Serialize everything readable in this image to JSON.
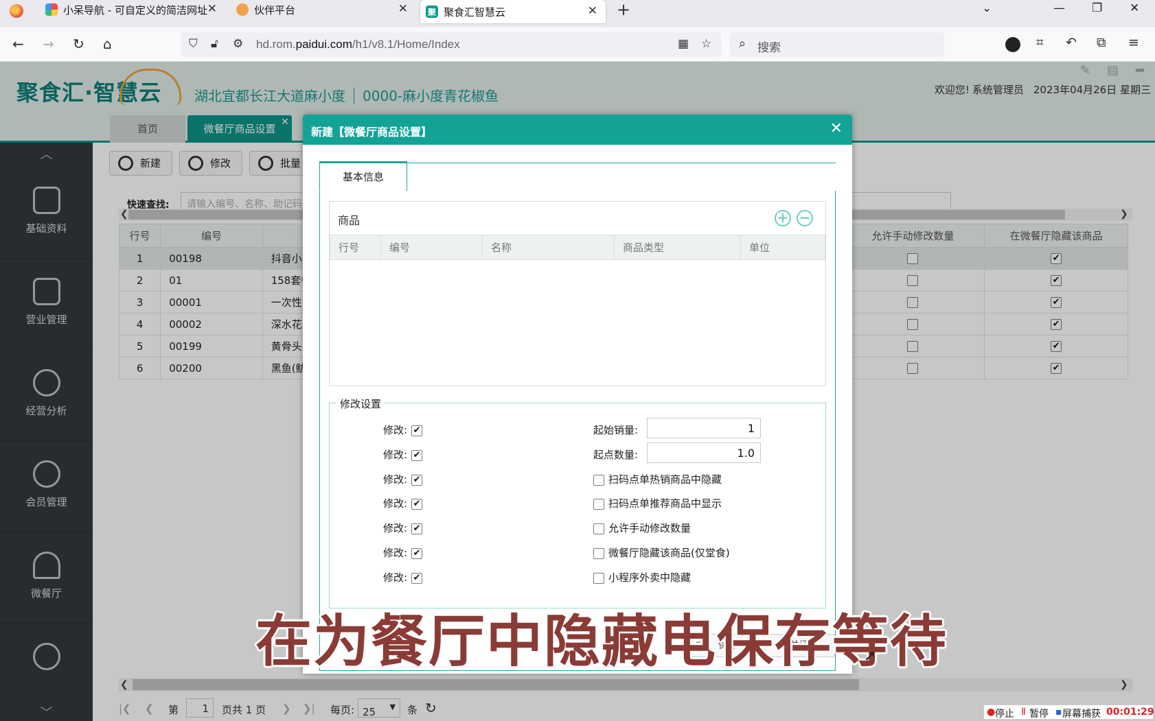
{
  "browser": {
    "tabs": [
      {
        "title": "小呆导航 - 可自定义的简洁网址",
        "favicon": "pinwheel-icon"
      },
      {
        "title": "伙伴平台",
        "favicon": "partner-icon"
      },
      {
        "title": "聚食汇智慧云",
        "favicon": "聚"
      }
    ],
    "url_host": "hd.rom.",
    "url_domain": "paidui.com",
    "url_path": "/h1/v8.1/Home/Index",
    "search_placeholder": "搜索"
  },
  "app": {
    "logo": "聚食汇·智慧云",
    "store_location": "湖北宜都长江大道麻小度",
    "store_name": "0000-麻小度青花椒鱼",
    "welcome": "欢迎您!",
    "user": "系统管理员",
    "date": "2023年04月26日 星期三",
    "tabs": {
      "home": "首页",
      "current": "微餐厅商品设置"
    }
  },
  "sidebar": {
    "items": [
      {
        "label": "基础资料",
        "icon": "document-icon"
      },
      {
        "label": "营业管理",
        "icon": "presentation-icon"
      },
      {
        "label": "经营分析",
        "icon": "pie-chart-icon"
      },
      {
        "label": "会员管理",
        "icon": "member-icon"
      },
      {
        "label": "微餐厅",
        "icon": "cloche-icon"
      },
      {
        "label": "",
        "icon": "chat-icon"
      }
    ]
  },
  "main": {
    "toolbar": {
      "new": "新建",
      "edit": "修改",
      "batch": "批量"
    },
    "quick_search_label": "快速查找:",
    "quick_search_placeholder": "请输入编号、名称、助记码",
    "columns": [
      "行号",
      "编号",
      "",
      "允许手动修改数量",
      "在微餐厅隐藏该商品"
    ],
    "rows": [
      {
        "no": "1",
        "code": "00198",
        "name": "抖音小",
        "allow": false,
        "hide": true
      },
      {
        "no": "2",
        "code": "01",
        "name": "158套餐",
        "allow": false,
        "hide": true
      },
      {
        "no": "3",
        "code": "00001",
        "name": "一次性",
        "allow": false,
        "hide": true
      },
      {
        "no": "4",
        "code": "00002",
        "name": "深水花",
        "allow": false,
        "hide": true
      },
      {
        "no": "5",
        "code": "00199",
        "name": "黄骨头",
        "allow": false,
        "hide": true
      },
      {
        "no": "6",
        "code": "00200",
        "name": "黑鱼(鲂",
        "allow": false,
        "hide": true
      }
    ],
    "pager": {
      "page_prefix": "第",
      "page": "1",
      "page_suffix": "页共 1 页",
      "per_page_label": "每页:",
      "per_page": "25",
      "unit": "条"
    }
  },
  "recorder": {
    "stop": "停止",
    "pause": "暂停",
    "capture": "屏幕捕获",
    "time": "00:01:29"
  },
  "modal": {
    "title": "新建【微餐厅商品设置】",
    "tab": "基本信息",
    "goods_panel_title": "商品",
    "goods_columns": [
      "行号",
      "编号",
      "名称",
      "商品类型",
      "单位"
    ],
    "modify_section": "修改设置",
    "modify_label": "修改:",
    "fields": {
      "start_sales_label": "起始销量:",
      "start_sales_value": "1",
      "start_qty_label": "起点数量:",
      "start_qty_value": "1.0"
    },
    "options": [
      {
        "label": "扫码点单热销商品中隐藏",
        "checked": false
      },
      {
        "label": "扫码点单推荐商品中显示",
        "checked": false
      },
      {
        "label": "允许手动修改数量",
        "checked": false
      },
      {
        "label": "微餐厅隐藏该商品(仅堂食)",
        "checked": false
      },
      {
        "label": "小程序外卖中隐藏",
        "checked": false
      }
    ],
    "buttons": {
      "save": "保存",
      "close": "关闭"
    }
  },
  "subtitle": "在为餐厅中隐藏电保存等待",
  "colors": {
    "accent": "#13a296",
    "sidebar": "#33393e",
    "subtitle": "#8a3b36"
  }
}
